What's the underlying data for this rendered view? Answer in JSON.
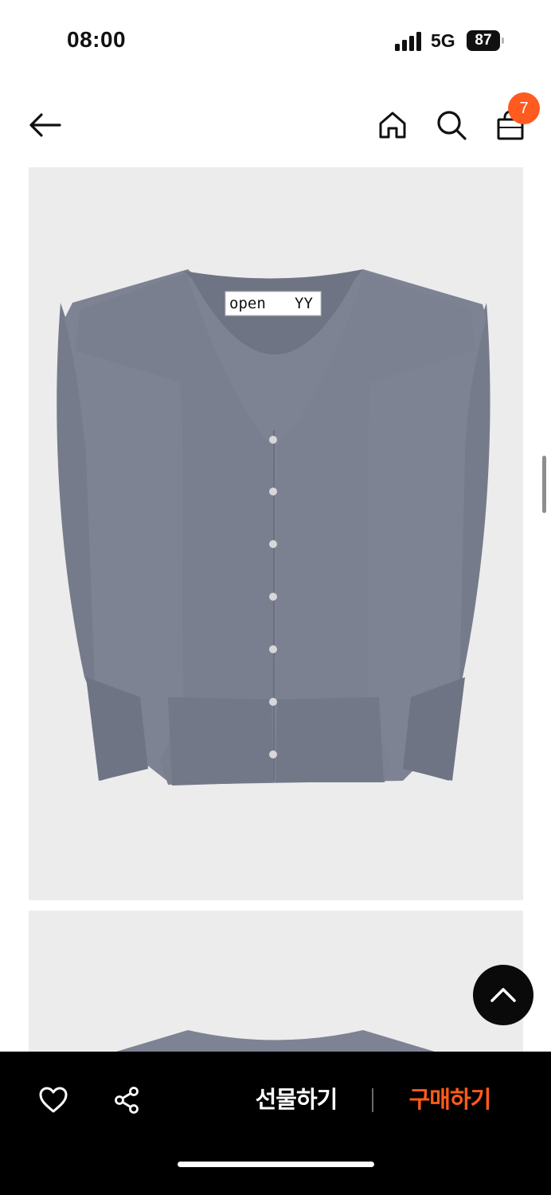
{
  "status_bar": {
    "time": "08:00",
    "network": "5G",
    "battery": "87"
  },
  "header": {
    "cart_count": "7",
    "icons": [
      "arrow-left-icon",
      "home-icon",
      "search-icon",
      "shopping-bag-icon"
    ]
  },
  "product": {
    "label_brand_left": "OPen",
    "label_brand_right": "YY",
    "image_count_visible": 2
  },
  "actions": {
    "gift_label": "선물하기",
    "buy_label": "구매하기",
    "icons": [
      "heart-icon",
      "share-icon",
      "chevron-up-icon"
    ]
  },
  "colors": {
    "accent": "#ff5a1f",
    "bottom_bar": "#000000",
    "image_background": "#ececec",
    "garment": "#7b8090"
  }
}
